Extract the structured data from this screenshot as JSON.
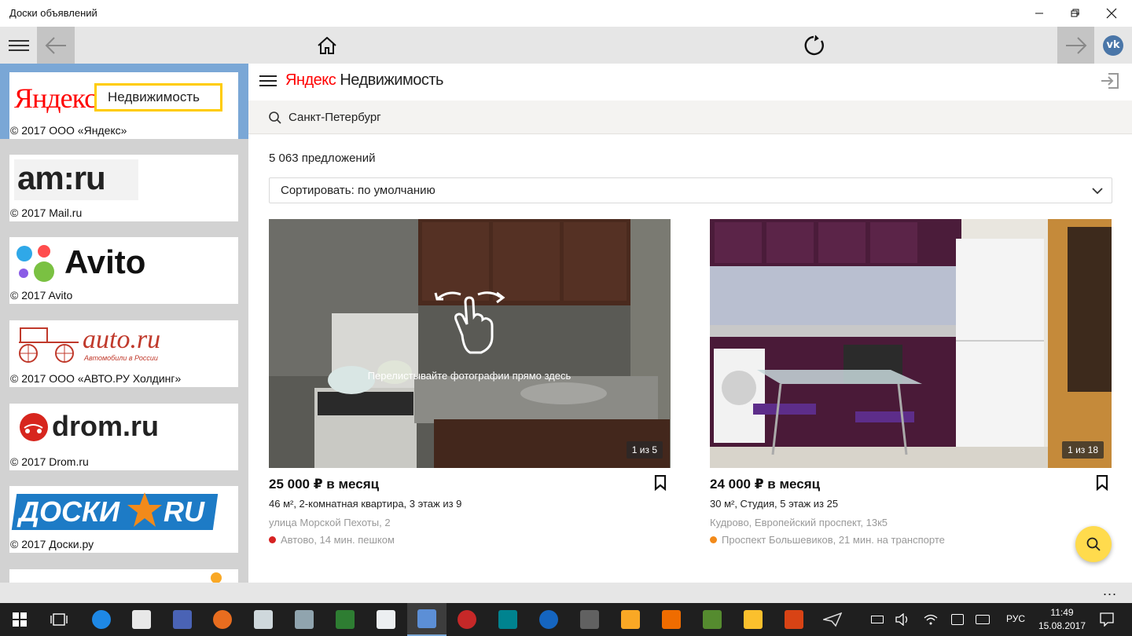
{
  "window": {
    "title": "Доски объявлений"
  },
  "colors": {
    "yandex_red": "#f00",
    "accent_blue": "#7aa7d6",
    "metro_red": "#d62222",
    "metro_orange": "#f28a1a",
    "fab_yellow": "#ffdb4d"
  },
  "icons": {
    "menu": "hamburger-icon",
    "back": "arrow-left-icon",
    "home": "home-icon",
    "refresh": "refresh-icon",
    "forward": "arrow-right-icon",
    "vk": "vk-icon",
    "login": "login-icon",
    "search": "search-icon",
    "bookmark": "bookmark-icon",
    "chevron": "chevron-down-icon",
    "swipe": "swipe-hand-icon"
  },
  "sidebar": {
    "items": [
      {
        "logo_main": "Яндекс",
        "logo_badge": "Недвижимость",
        "caption": "© 2017 ООО «Яндекс»"
      },
      {
        "logo_main": "am:ru",
        "caption": "© 2017 Mail.ru"
      },
      {
        "logo_main": "Avito",
        "caption": "© 2017 Avito"
      },
      {
        "logo_main": "auto.ru",
        "logo_sub": "Автомобили в России",
        "caption": "© 2017 ООО «АВТО.РУ Холдинг»"
      },
      {
        "logo_main": "drom.ru",
        "caption": "© 2017 Drom.ru"
      },
      {
        "logo_main": "ДОСКИ",
        "logo_badge": "RU",
        "caption": "© 2017 Доски.ру"
      }
    ]
  },
  "header": {
    "brand_a": "Яндекс",
    "brand_b": "Недвижимость"
  },
  "search": {
    "location": "Санкт-Петербург"
  },
  "results": {
    "count": "5 063 предложений",
    "sort": "Сортировать: по умолчанию"
  },
  "listings": [
    {
      "price": "25 000 ₽ в месяц",
      "details": "46 м², 2-комнатная квартира, 3 этаж из 9",
      "address": "улица Морской Пехоты, 2",
      "metro": "Автово, 14 мин. пешком",
      "photo_counter": "1 из 5",
      "hint": "Перелистывайте фотографии прямо здесь"
    },
    {
      "price": "24 000 ₽ в месяц",
      "details": "30 м², Студия, 5 этаж из 25",
      "address": "Кудрово, Европейский проспект, 13к5",
      "metro": "Проспект Большевиков, 21 мин. на транспорте",
      "photo_counter": "1 из 18"
    }
  ],
  "appbar": {
    "more": "..."
  },
  "taskbar": {
    "lang": "РУС",
    "time": "11:49",
    "date": "15.08.2017"
  }
}
